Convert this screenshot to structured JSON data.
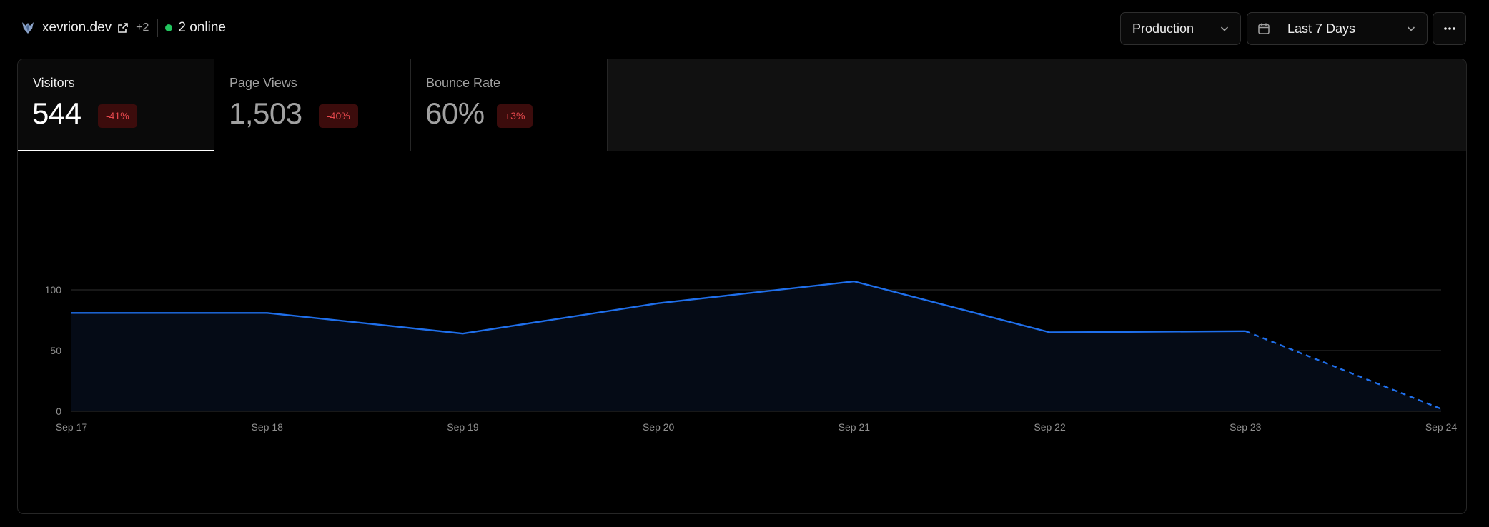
{
  "project": {
    "name": "xevrion.dev",
    "extra_count": "+2",
    "online_text": "2 online"
  },
  "controls": {
    "environment": "Production",
    "date_range": "Last 7 Days"
  },
  "stats": [
    {
      "label": "Visitors",
      "value": "544",
      "change": "-41%",
      "selected": true
    },
    {
      "label": "Page Views",
      "value": "1,503",
      "change": "-40%",
      "selected": false
    },
    {
      "label": "Bounce Rate",
      "value": "60%",
      "change": "+3%",
      "selected": false
    }
  ],
  "colors": {
    "accent_line": "#1f6feb",
    "online_dot": "#22c55e",
    "badge_text": "#e5484d",
    "badge_bg": "#3c0c0c"
  },
  "icons": {
    "logo": "bird-logo-icon",
    "external": "external-link-icon",
    "calendar": "calendar-icon",
    "chevron": "chevron-down-icon",
    "more": "more-horizontal-icon"
  },
  "chart_data": {
    "type": "area",
    "x": [
      "Sep 17",
      "Sep 18",
      "Sep 19",
      "Sep 20",
      "Sep 21",
      "Sep 22",
      "Sep 23",
      "Sep 24"
    ],
    "series": [
      {
        "values": [
          81,
          81,
          64,
          89,
          107,
          65,
          66,
          2
        ]
      }
    ],
    "partial_last_segment": true,
    "yticks": [
      0,
      50,
      100
    ],
    "ylim": [
      0,
      100
    ],
    "grid": true
  }
}
